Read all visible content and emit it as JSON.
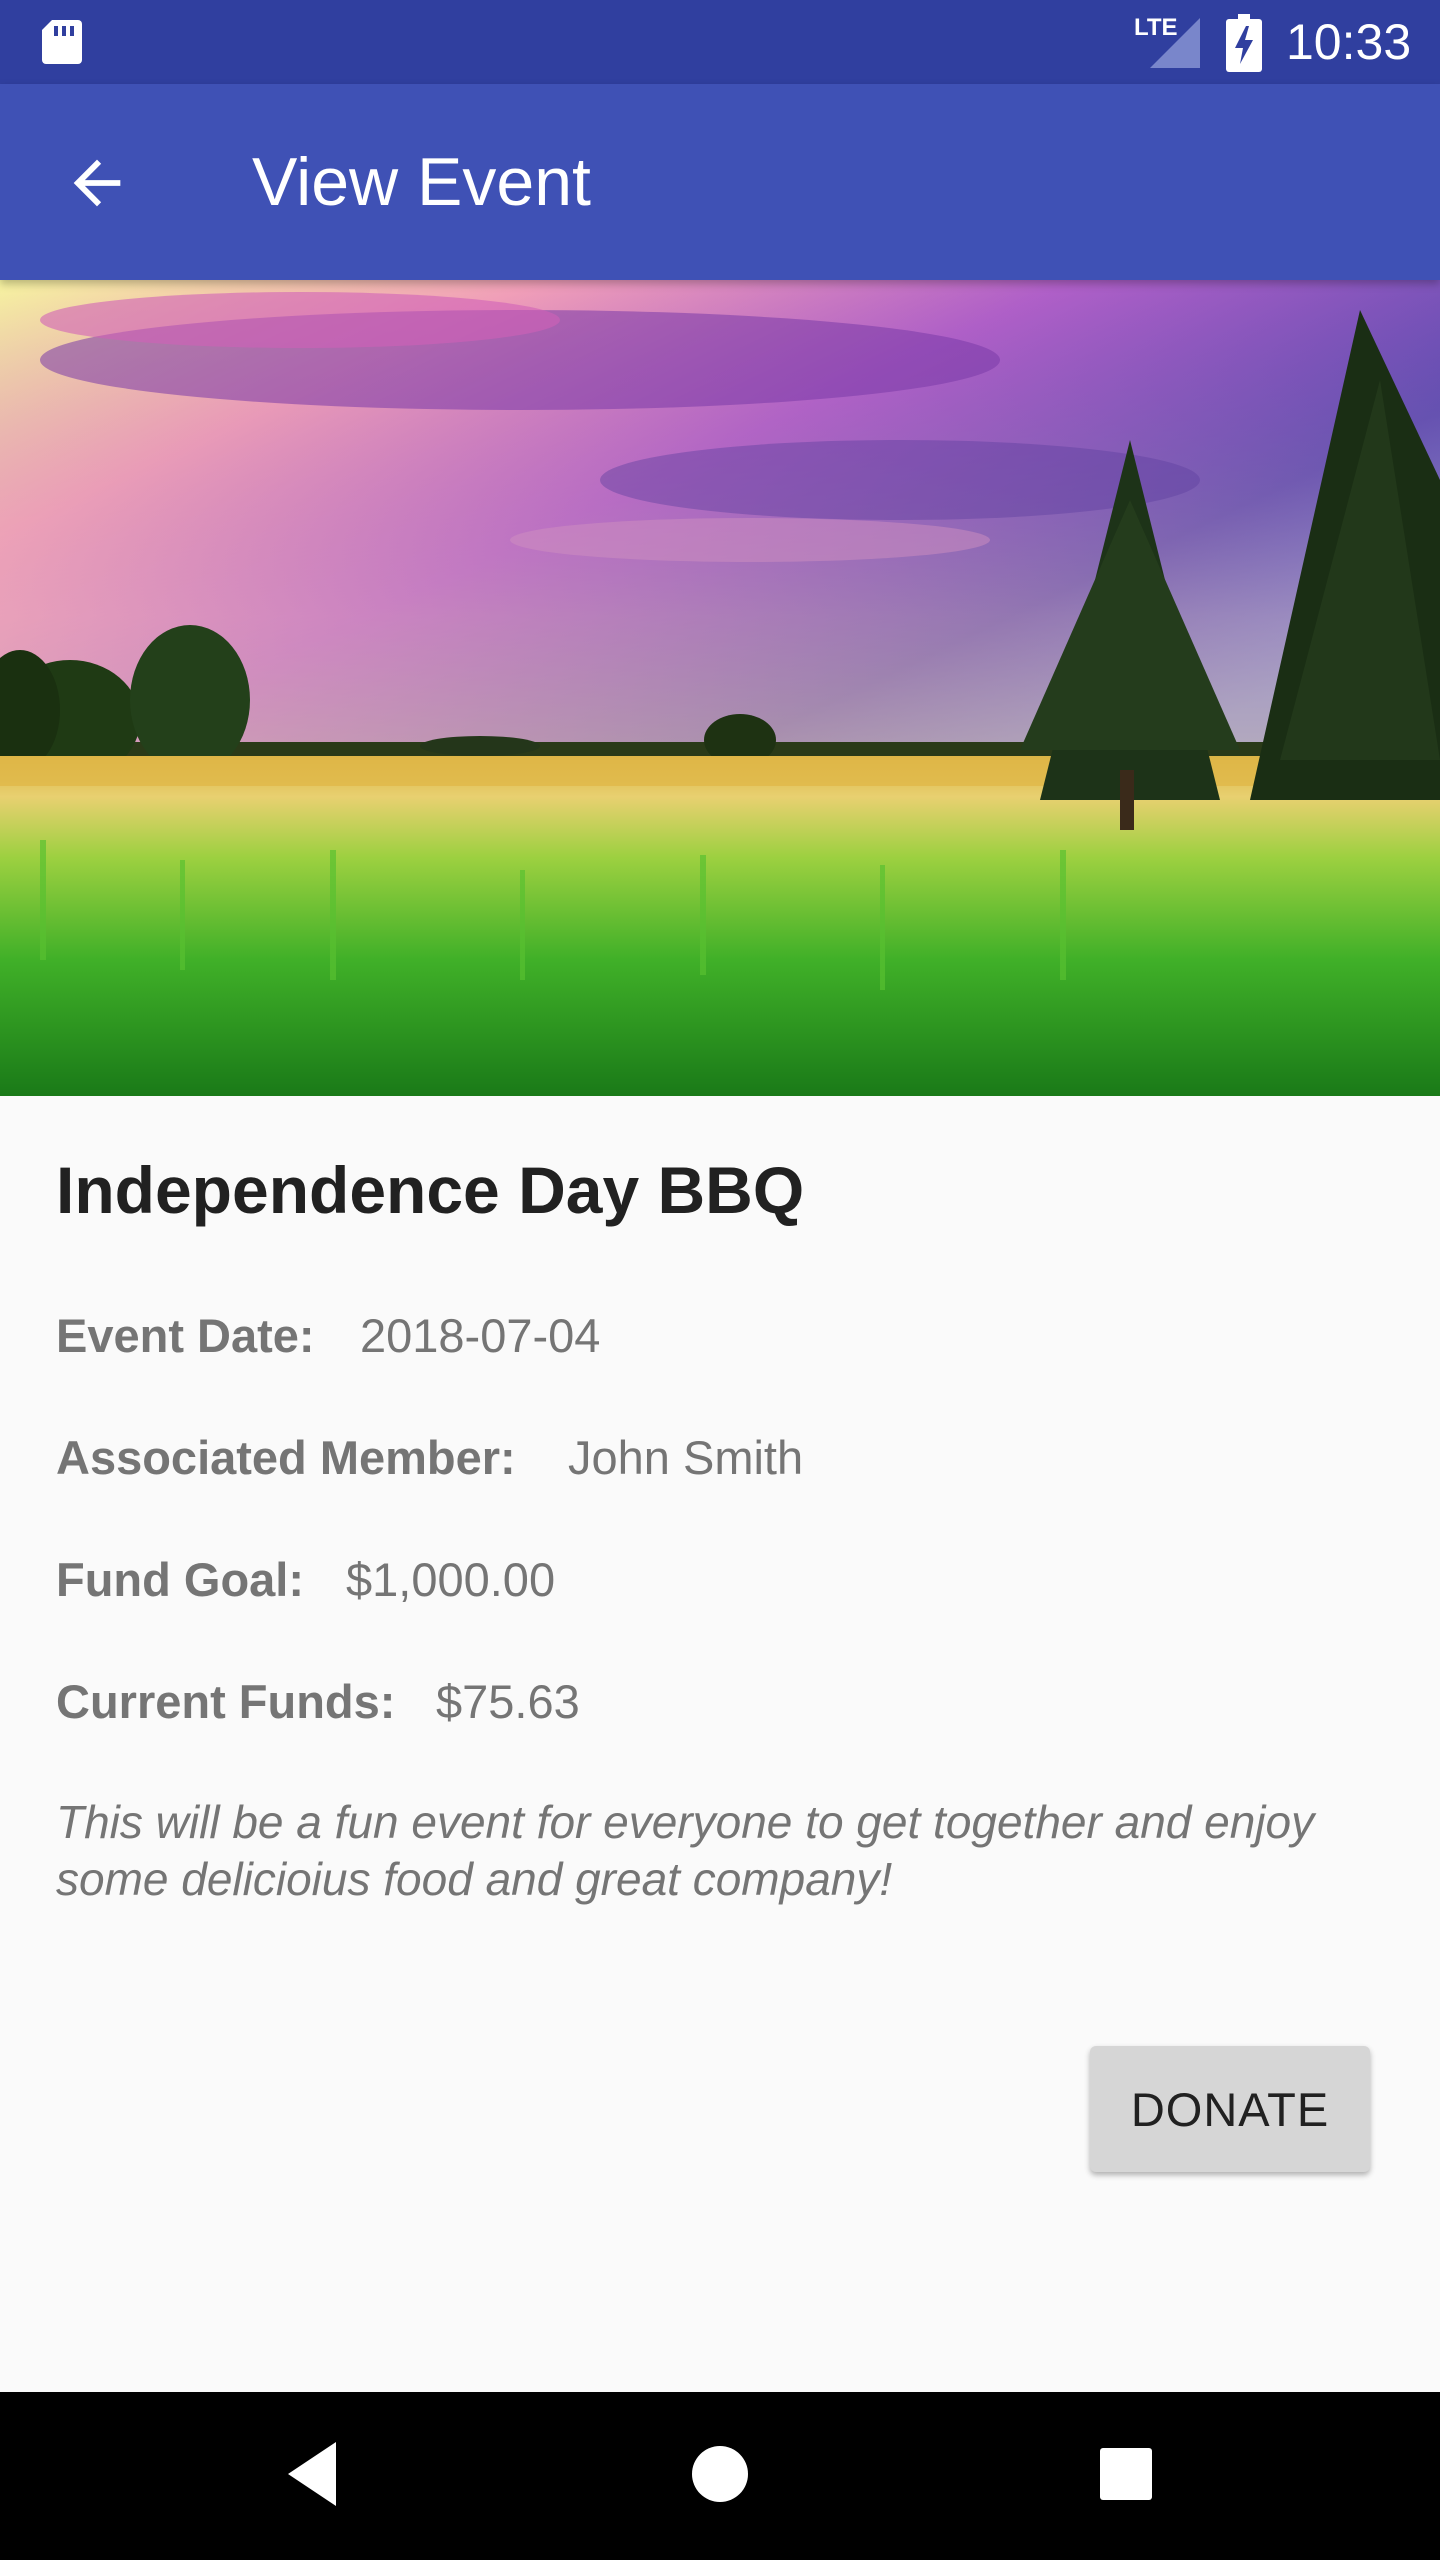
{
  "status_bar": {
    "network_label": "LTE",
    "time": "10:33",
    "icons": [
      "sd-card-icon",
      "signal-icon",
      "battery-charging-icon"
    ]
  },
  "app_bar": {
    "title": "View Event",
    "back_icon": "arrow-back-icon"
  },
  "hero": {
    "image": "landscape-photo"
  },
  "event": {
    "title": "Independence Day BBQ",
    "date_label": "Event Date:",
    "date_value": "2018-07-04",
    "member_label": "Associated Member:",
    "member_value": "John Smith",
    "goal_label": "Fund Goal:",
    "goal_value": "$1,000.00",
    "funds_label": "Current Funds:",
    "funds_value": "$75.63",
    "description": "This will be a fun event for everyone to get together and enjoy some delicioius food and great company!"
  },
  "actions": {
    "donate_label": "DONATE"
  },
  "nav_bar": {
    "icons": [
      "nav-back-icon",
      "nav-home-icon",
      "nav-recents-icon"
    ]
  },
  "colors": {
    "status_bar": "#303f9f",
    "app_bar": "#3f51b5",
    "background": "#fafafa",
    "button": "#d6d6d6"
  }
}
